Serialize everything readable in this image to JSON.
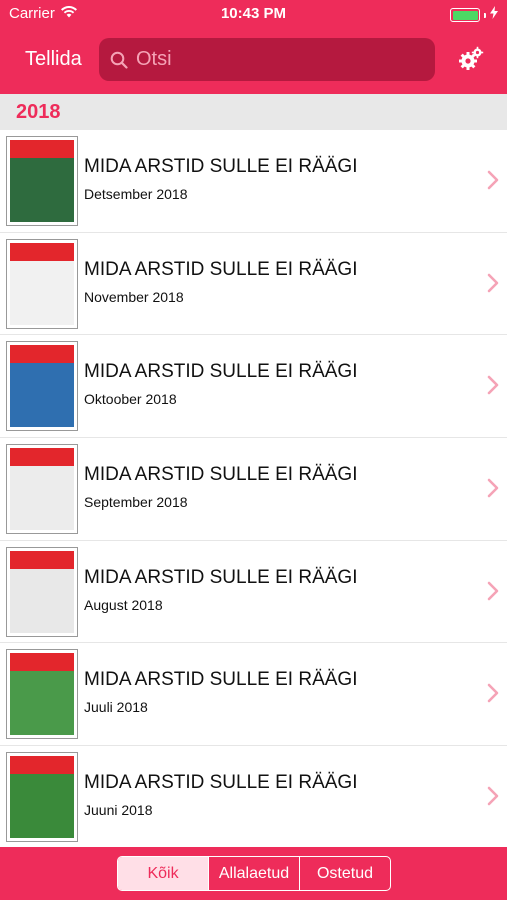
{
  "status_bar": {
    "carrier": "Carrier",
    "time": "10:43 PM",
    "battery_level": 1.0
  },
  "nav": {
    "title": "Tellida",
    "search_placeholder": "Otsi"
  },
  "section": {
    "title": "2018"
  },
  "issues": [
    {
      "title": "MIDA ARSTID SULLE EI RÄÄGI",
      "date": "Detsember 2018",
      "cover_color": "#2e6b3e"
    },
    {
      "title": "MIDA ARSTID SULLE EI RÄÄGI",
      "date": "November 2018",
      "cover_color": "#f1f1f1"
    },
    {
      "title": "MIDA ARSTID SULLE EI RÄÄGI",
      "date": "Oktoober 2018",
      "cover_color": "#2f6fb0"
    },
    {
      "title": "MIDA ARSTID SULLE EI RÄÄGI",
      "date": "September 2018",
      "cover_color": "#ececec"
    },
    {
      "title": "MIDA ARSTID SULLE EI RÄÄGI",
      "date": "August 2018",
      "cover_color": "#e8e8e8"
    },
    {
      "title": "MIDA ARSTID SULLE EI RÄÄGI",
      "date": "Juuli 2018",
      "cover_color": "#4a9a4a"
    },
    {
      "title": "MIDA ARSTID SULLE EI RÄÄGI",
      "date": "Juuni 2018",
      "cover_color": "#3a8a3a"
    }
  ],
  "tabs": [
    {
      "label": "Kõik",
      "active": true
    },
    {
      "label": "Allalaetud",
      "active": false
    },
    {
      "label": "Ostetud",
      "active": false
    }
  ],
  "colors": {
    "accent": "#ee2c5a",
    "search_bg": "#b5193f",
    "section_bg": "#e8e8e8",
    "battery": "#4cd964"
  }
}
